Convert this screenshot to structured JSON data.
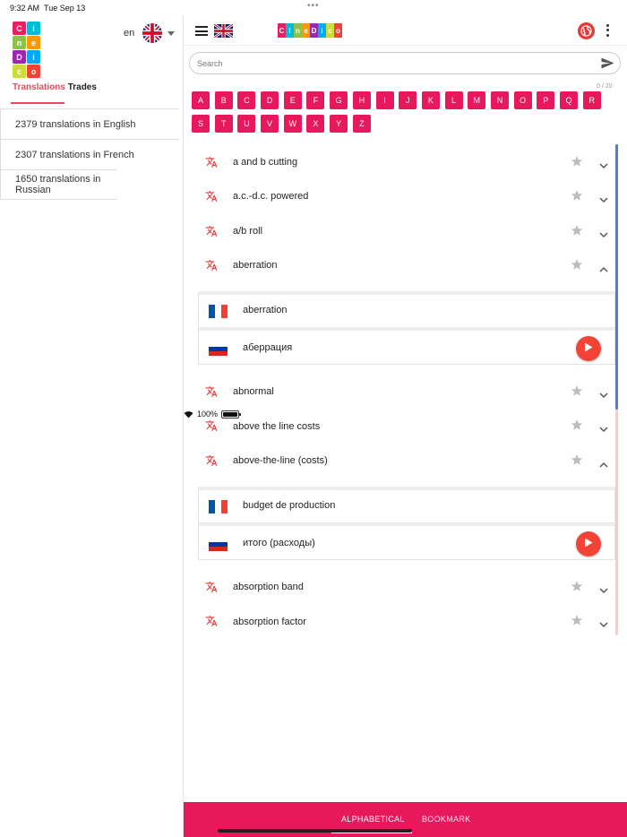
{
  "status": {
    "time": "9:32 AM",
    "date": "Tue Sep 13",
    "battery": "100%",
    "battery_level": 1.0
  },
  "colors": {
    "accent": "#e8185c",
    "tab_active": "#e84a5f",
    "play": "#f24336"
  },
  "brand": {
    "logo_letters": [
      "C",
      "i",
      "n",
      "e",
      "D",
      "i",
      "c",
      "o"
    ],
    "logo_colors": [
      "#e91e63",
      "#00bcd4",
      "#8bc34a",
      "#ff9800",
      "#9c27b0",
      "#03a9f4",
      "#cddc39",
      "#f44336"
    ]
  },
  "left": {
    "language_code": "en",
    "tabs": {
      "translations": "Translations",
      "trades": "Trades"
    },
    "stats": [
      "2379 translations in English",
      "2307 translations in French",
      "1650 translations in Russian"
    ]
  },
  "search": {
    "placeholder": "Search",
    "value": "",
    "counter": "0 / 20"
  },
  "alphabet": [
    "A",
    "B",
    "C",
    "D",
    "E",
    "F",
    "G",
    "H",
    "I",
    "J",
    "K",
    "L",
    "M",
    "N",
    "O",
    "P",
    "Q",
    "R",
    "S",
    "T",
    "U",
    "V",
    "W",
    "X",
    "Y",
    "Z"
  ],
  "terms": [
    {
      "term": "a and b cutting",
      "expanded": false
    },
    {
      "term": "a.c.-d.c. powered",
      "expanded": false
    },
    {
      "term": "a/b roll",
      "expanded": false
    },
    {
      "term": "aberration",
      "expanded": true,
      "translations": [
        {
          "lang": "fr",
          "text": "aberration",
          "audio": false
        },
        {
          "lang": "ru",
          "text": "аберрация",
          "audio": true
        }
      ]
    },
    {
      "term": "abnormal",
      "expanded": false
    },
    {
      "term": "above the line costs",
      "expanded": false
    },
    {
      "term": "above-the-line (costs)",
      "expanded": true,
      "translations": [
        {
          "lang": "fr",
          "text": "budget de production",
          "audio": false
        },
        {
          "lang": "ru",
          "text": "итого (расходы)",
          "audio": true
        }
      ]
    },
    {
      "term": "absorption band",
      "expanded": false
    },
    {
      "term": "absorption factor",
      "expanded": false
    }
  ],
  "bottom_nav": {
    "alphabetical": "ALPHABETICAL",
    "bookmark": "BOOKMARK"
  },
  "icons": {
    "menu": "hamburger-icon",
    "globe": "globe-icon",
    "more": "more-vert-icon",
    "send": "send-icon",
    "translate": "translate-icon",
    "star": "star-icon",
    "chevron": "chevron-icon",
    "play": "play-icon"
  }
}
